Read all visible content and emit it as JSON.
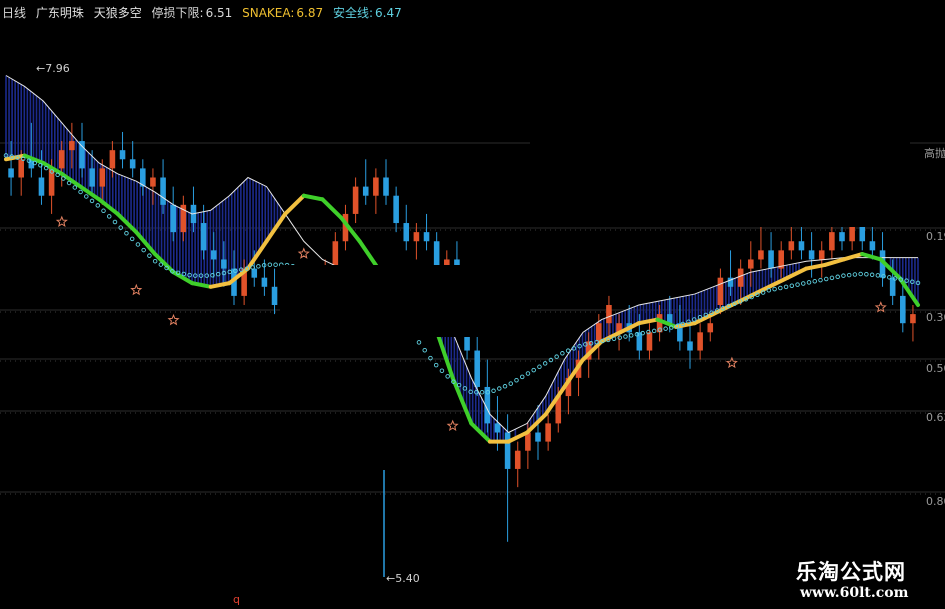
{
  "header": {
    "period": "日线",
    "name": "广东明珠",
    "trend": "天狼多空",
    "stop_label": "停损下限:",
    "stop_value": "6.51",
    "snake_label": "SNAKEA:",
    "snake_value": "6.87",
    "safe_label": "安全线:",
    "safe_value": "6.47"
  },
  "right_axis": {
    "label": "高抛",
    "ticks": [
      "0.19",
      "0.30",
      "0.50",
      "0.62",
      "0.80"
    ]
  },
  "annotations": {
    "high_price": "7.96",
    "low_price": "5.40",
    "bottom_mark": "q"
  },
  "watermark": {
    "title": "乐淘公式网",
    "url": "www.60lt.com"
  },
  "colors": {
    "up": "#e0522a",
    "down": "#2a9ee0",
    "snake_up": "#f2c040",
    "snake_down": "#3fcf2a",
    "safe_dots": "#5fd0e0",
    "band": "#1c2a8c",
    "upper_line": "#e8e8e8",
    "diamond": "#5fb0e8",
    "star": "#e08060"
  },
  "chart_data": {
    "type": "candlestick",
    "title": "广东明珠 天狼多空",
    "ylim": [
      5.3,
      8.1
    ],
    "candles": [
      [
        7.45,
        7.6,
        7.3,
        7.4
      ],
      [
        7.4,
        7.55,
        7.3,
        7.5
      ],
      [
        7.5,
        7.7,
        7.4,
        7.45
      ],
      [
        7.4,
        7.55,
        7.25,
        7.3
      ],
      [
        7.3,
        7.5,
        7.2,
        7.45
      ],
      [
        7.45,
        7.6,
        7.35,
        7.55
      ],
      [
        7.55,
        7.7,
        7.45,
        7.6
      ],
      [
        7.6,
        7.7,
        7.4,
        7.45
      ],
      [
        7.45,
        7.55,
        7.3,
        7.35
      ],
      [
        7.35,
        7.5,
        7.25,
        7.45
      ],
      [
        7.45,
        7.6,
        7.4,
        7.55
      ],
      [
        7.55,
        7.65,
        7.45,
        7.5
      ],
      [
        7.5,
        7.6,
        7.4,
        7.45
      ],
      [
        7.45,
        7.5,
        7.3,
        7.35
      ],
      [
        7.35,
        7.45,
        7.25,
        7.4
      ],
      [
        7.4,
        7.5,
        7.2,
        7.25
      ],
      [
        7.25,
        7.35,
        7.05,
        7.1
      ],
      [
        7.1,
        7.3,
        7.05,
        7.25
      ],
      [
        7.25,
        7.35,
        7.1,
        7.15
      ],
      [
        7.15,
        7.25,
        6.95,
        7.0
      ],
      [
        7.0,
        7.1,
        6.85,
        6.95
      ],
      [
        6.95,
        7.05,
        6.8,
        6.9
      ],
      [
        6.9,
        7.0,
        6.7,
        6.75
      ],
      [
        6.75,
        6.95,
        6.7,
        6.9
      ],
      [
        6.9,
        7.0,
        6.8,
        6.85
      ],
      [
        6.85,
        6.95,
        6.75,
        6.8
      ],
      [
        6.8,
        6.9,
        6.65,
        6.7
      ],
      [
        6.7,
        6.85,
        6.65,
        6.8
      ],
      [
        6.8,
        6.9,
        6.7,
        6.75
      ],
      [
        6.75,
        6.85,
        6.6,
        6.65
      ],
      [
        6.65,
        6.8,
        6.6,
        6.75
      ],
      [
        6.75,
        6.95,
        6.7,
        6.9
      ],
      [
        6.9,
        7.1,
        6.85,
        7.05
      ],
      [
        7.05,
        7.25,
        7.0,
        7.2
      ],
      [
        7.2,
        7.4,
        7.15,
        7.35
      ],
      [
        7.35,
        7.5,
        7.25,
        7.3
      ],
      [
        7.3,
        7.45,
        7.2,
        7.4
      ],
      [
        7.4,
        7.5,
        7.25,
        7.3
      ],
      [
        7.3,
        7.35,
        7.1,
        7.15
      ],
      [
        7.15,
        7.25,
        7.0,
        7.05
      ],
      [
        7.05,
        7.15,
        6.95,
        7.1
      ],
      [
        7.1,
        7.2,
        7.0,
        7.05
      ],
      [
        7.05,
        7.1,
        6.85,
        6.9
      ],
      [
        6.9,
        7.0,
        6.8,
        6.95
      ],
      [
        6.95,
        7.05,
        6.85,
        6.9
      ],
      [
        6.7,
        6.8,
        6.4,
        6.45
      ],
      [
        6.45,
        6.55,
        6.2,
        6.25
      ],
      [
        6.25,
        6.4,
        6.0,
        6.05
      ],
      [
        6.05,
        6.2,
        5.9,
        6.0
      ],
      [
        6.0,
        6.1,
        5.4,
        5.8
      ],
      [
        5.8,
        5.95,
        5.7,
        5.9
      ],
      [
        5.9,
        6.05,
        5.8,
        6.0
      ],
      [
        6.0,
        6.15,
        5.85,
        5.95
      ],
      [
        5.95,
        6.1,
        5.9,
        6.05
      ],
      [
        6.05,
        6.25,
        6.0,
        6.2
      ],
      [
        6.2,
        6.35,
        6.1,
        6.3
      ],
      [
        6.3,
        6.45,
        6.2,
        6.4
      ],
      [
        6.4,
        6.55,
        6.3,
        6.5
      ],
      [
        6.5,
        6.65,
        6.4,
        6.6
      ],
      [
        6.6,
        6.75,
        6.5,
        6.7
      ],
      [
        6.55,
        6.65,
        6.45,
        6.6
      ],
      [
        6.6,
        6.7,
        6.5,
        6.55
      ],
      [
        6.55,
        6.65,
        6.4,
        6.45
      ],
      [
        6.45,
        6.6,
        6.4,
        6.55
      ],
      [
        6.55,
        6.7,
        6.5,
        6.65
      ],
      [
        6.65,
        6.75,
        6.55,
        6.6
      ],
      [
        6.6,
        6.7,
        6.45,
        6.5
      ],
      [
        6.5,
        6.6,
        6.35,
        6.45
      ],
      [
        6.45,
        6.6,
        6.4,
        6.55
      ],
      [
        6.55,
        6.65,
        6.5,
        6.6
      ],
      [
        6.7,
        6.9,
        6.65,
        6.85
      ],
      [
        6.85,
        7.0,
        6.75,
        6.8
      ],
      [
        6.8,
        6.95,
        6.7,
        6.9
      ],
      [
        6.9,
        7.05,
        6.8,
        6.95
      ],
      [
        6.95,
        7.15,
        6.9,
        7.0
      ],
      [
        7.0,
        7.1,
        6.85,
        6.9
      ],
      [
        6.9,
        7.05,
        6.85,
        7.0
      ],
      [
        7.0,
        7.15,
        6.95,
        7.05
      ],
      [
        7.05,
        7.2,
        6.95,
        7.0
      ],
      [
        7.0,
        7.1,
        6.85,
        6.95
      ],
      [
        6.95,
        7.05,
        6.85,
        7.0
      ],
      [
        7.0,
        7.15,
        6.95,
        7.1
      ],
      [
        7.1,
        7.2,
        7.0,
        7.05
      ],
      [
        7.05,
        7.25,
        7.0,
        7.15
      ],
      [
        7.15,
        7.25,
        7.0,
        7.05
      ],
      [
        7.05,
        7.15,
        6.95,
        7.0
      ],
      [
        7.0,
        7.1,
        6.8,
        6.85
      ],
      [
        6.85,
        6.95,
        6.7,
        6.75
      ],
      [
        6.75,
        6.85,
        6.55,
        6.6
      ],
      [
        6.6,
        6.7,
        6.5,
        6.65
      ]
    ],
    "snake": [
      7.5,
      7.52,
      7.48,
      7.42,
      7.35,
      7.28,
      7.2,
      7.1,
      6.98,
      6.88,
      6.82,
      6.8,
      6.82,
      6.9,
      7.05,
      7.2,
      7.3,
      7.28,
      7.18,
      7.05,
      6.9,
      6.85,
      6.8,
      6.6,
      6.3,
      6.05,
      5.95,
      5.95,
      6.0,
      6.1,
      6.25,
      6.4,
      6.5,
      6.55,
      6.6,
      6.62,
      6.58,
      6.6,
      6.65,
      6.7,
      6.75,
      6.8,
      6.85,
      6.9,
      6.92,
      6.95,
      6.98,
      6.95,
      6.85,
      6.7
    ],
    "safe_line": [
      7.62,
      7.6,
      7.56,
      7.5,
      7.42,
      7.34,
      7.24,
      7.14,
      7.04,
      6.98,
      6.96,
      6.96,
      6.98,
      7.0,
      7.02,
      7.02,
      7.0,
      6.98,
      6.96,
      6.92,
      6.86,
      6.76,
      6.62,
      6.48,
      6.38,
      6.32,
      6.32,
      6.36,
      6.42,
      6.48,
      6.54,
      6.58,
      6.6,
      6.62,
      6.64,
      6.66,
      6.68,
      6.72,
      6.76,
      6.8,
      6.84,
      6.88,
      6.9,
      6.92,
      6.94,
      6.96,
      6.97,
      6.96,
      6.94,
      6.92
    ],
    "upper_band": [
      7.96,
      7.9,
      7.82,
      7.7,
      7.58,
      7.48,
      7.42,
      7.38,
      7.32,
      7.25,
      7.2,
      7.22,
      7.3,
      7.4,
      7.35,
      7.2,
      7.05,
      6.95,
      6.9,
      6.85,
      6.85,
      6.8,
      6.75,
      6.7,
      6.55,
      6.3,
      6.1,
      6.0,
      6.05,
      6.2,
      6.4,
      6.55,
      6.62,
      6.66,
      6.7,
      6.72,
      6.74,
      6.76,
      6.8,
      6.84,
      6.88,
      6.9,
      6.92,
      6.94,
      6.95,
      6.96,
      6.96,
      6.96,
      6.96,
      6.96
    ],
    "buy_diamonds": [
      1,
      3,
      4,
      6,
      7,
      10,
      11,
      13,
      23
    ],
    "sell_stars": [
      3,
      7,
      9,
      16,
      24,
      39,
      47,
      50
    ]
  }
}
